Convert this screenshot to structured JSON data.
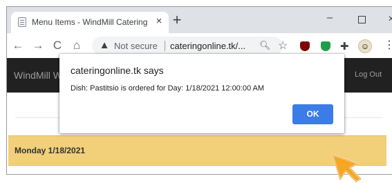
{
  "browser": {
    "tab": {
      "title": "Menu Items - WindMill Catering",
      "close": "×"
    },
    "newtab": "+",
    "window": {
      "minimize": "–",
      "close": "×"
    },
    "toolbar": {
      "back": "←",
      "forward": "→",
      "reload": "C",
      "home": "⌂",
      "not_secure": "Not secure",
      "url": "cateringonline.tk/...",
      "zoom": "🔍︎",
      "star": "☆",
      "puzzle": "✚",
      "menu": "⋮"
    }
  },
  "site": {
    "brand": "WindMill W",
    "logout": "Log Out",
    "day_heading": "Monday 1/18/2021"
  },
  "dialog": {
    "title": "cateringonline.tk says",
    "message": "Dish: Pastitsio is ordered for Day: 1/18/2021 12:00:00 AM",
    "ok": "OK"
  },
  "colors": {
    "accent": "#3b7ce6",
    "navbar": "#212121",
    "day_heading_bg": "#f2cf79",
    "cursor": "#f5a623"
  }
}
